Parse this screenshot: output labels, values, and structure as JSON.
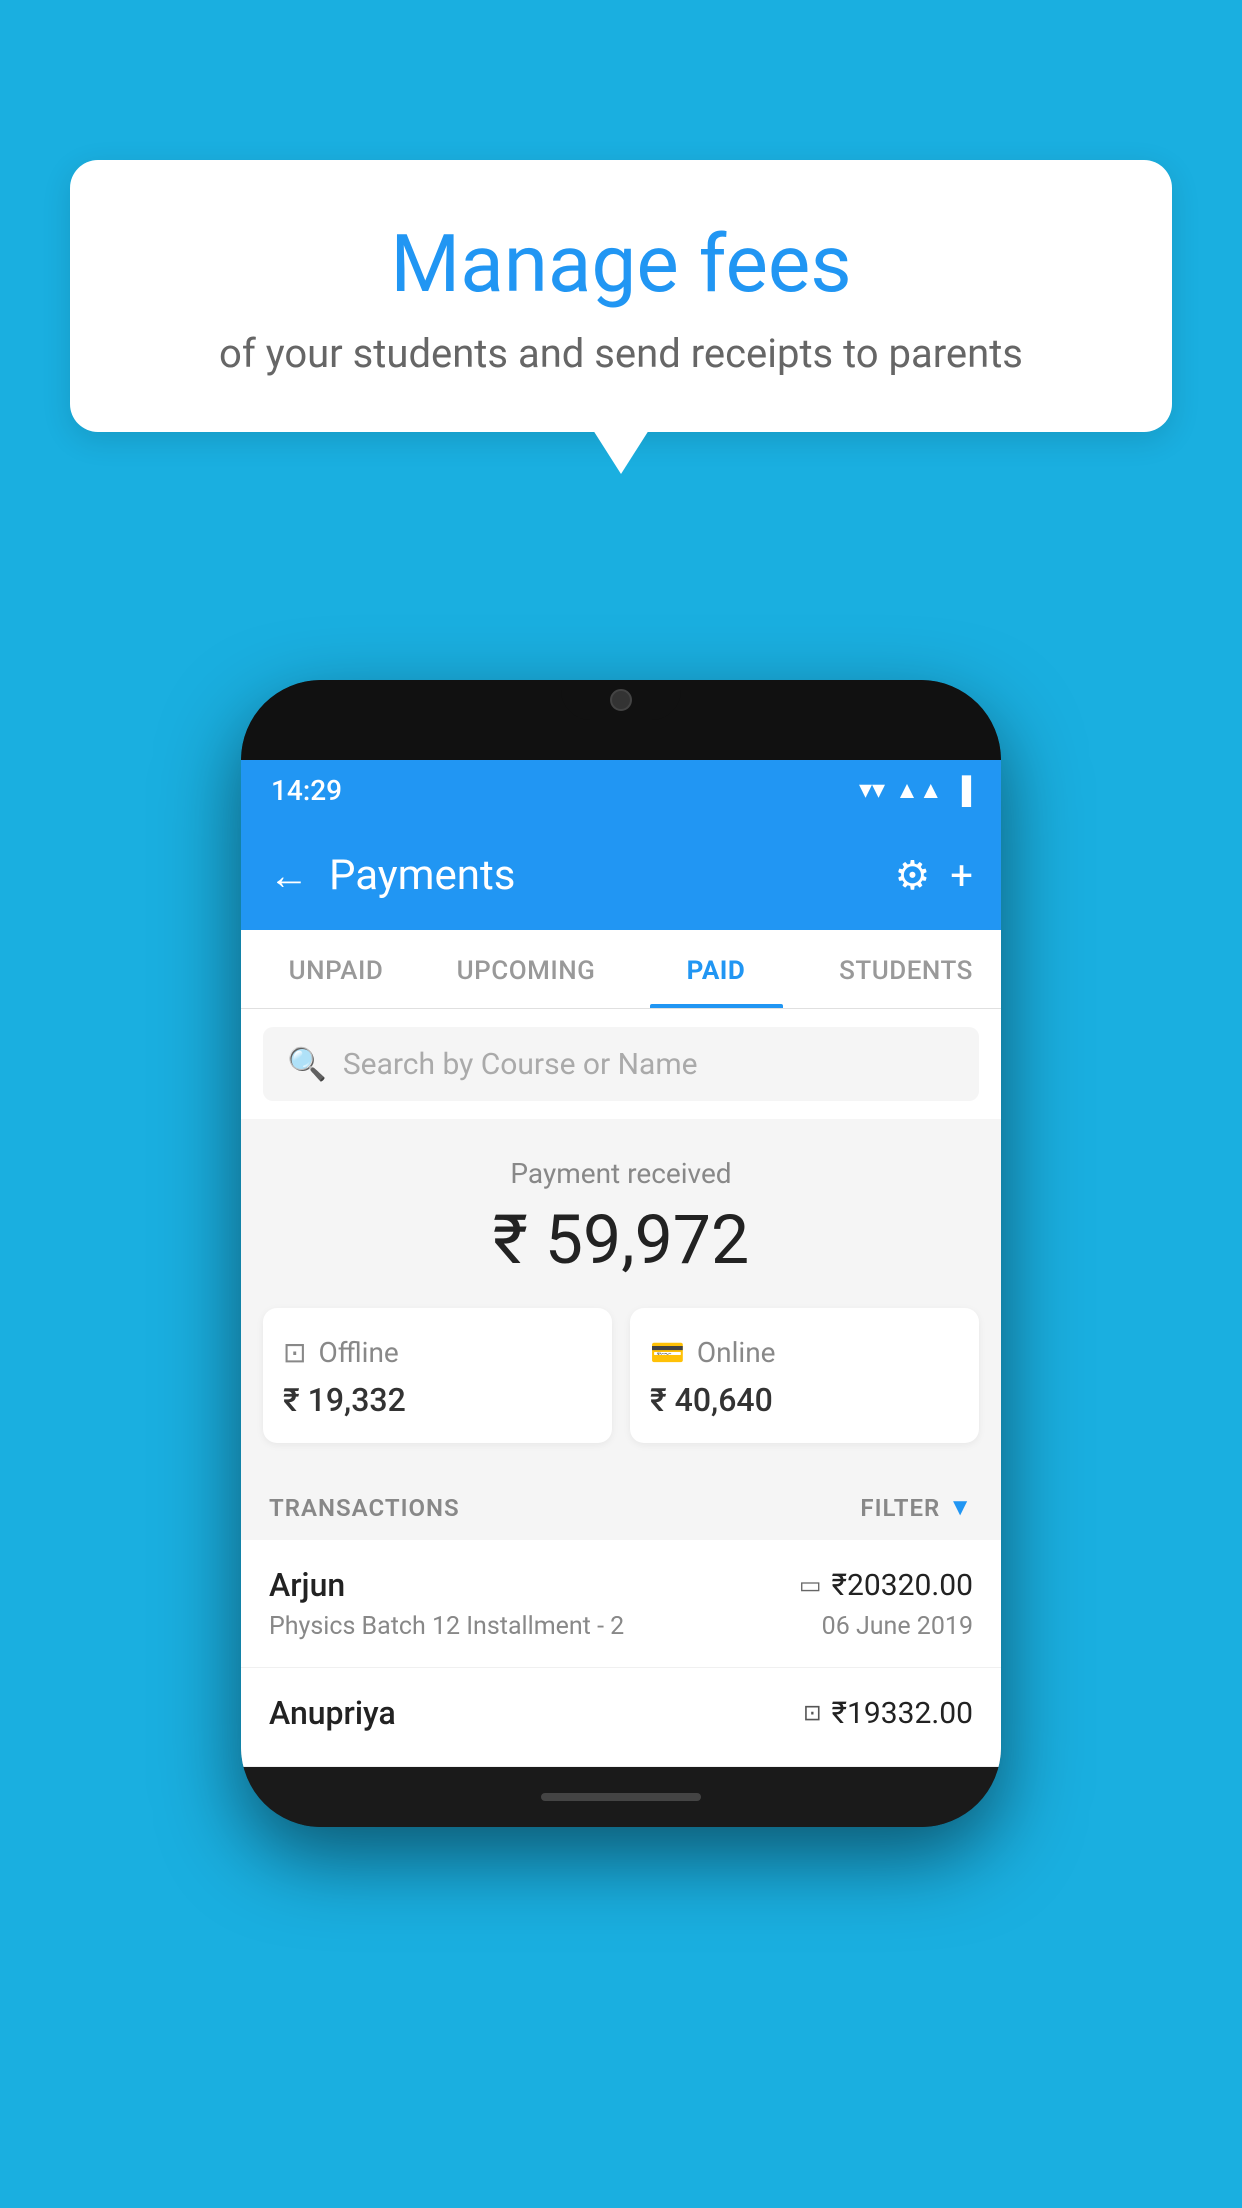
{
  "background_color": "#1AAFE0",
  "bubble": {
    "title": "Manage fees",
    "subtitle": "of your students and send receipts to parents"
  },
  "status_bar": {
    "time": "14:29",
    "wifi": "▼",
    "signal": "▲",
    "battery": "▌"
  },
  "header": {
    "title": "Payments",
    "back_label": "←",
    "gear_label": "⚙",
    "plus_label": "+"
  },
  "tabs": [
    {
      "label": "UNPAID",
      "active": false
    },
    {
      "label": "UPCOMING",
      "active": false
    },
    {
      "label": "PAID",
      "active": true
    },
    {
      "label": "STUDENTS",
      "active": false
    }
  ],
  "search": {
    "placeholder": "Search by Course or Name"
  },
  "payment": {
    "label": "Payment received",
    "amount": "₹ 59,972",
    "offline": {
      "type": "Offline",
      "amount": "₹ 19,332"
    },
    "online": {
      "type": "Online",
      "amount": "₹ 40,640"
    }
  },
  "transactions": {
    "label": "TRANSACTIONS",
    "filter_label": "FILTER",
    "items": [
      {
        "name": "Arjun",
        "amount": "₹20320.00",
        "payment_type": "card",
        "course": "Physics Batch 12 Installment - 2",
        "date": "06 June 2019"
      },
      {
        "name": "Anupriya",
        "amount": "₹19332.00",
        "payment_type": "cash",
        "course": "",
        "date": ""
      }
    ]
  }
}
